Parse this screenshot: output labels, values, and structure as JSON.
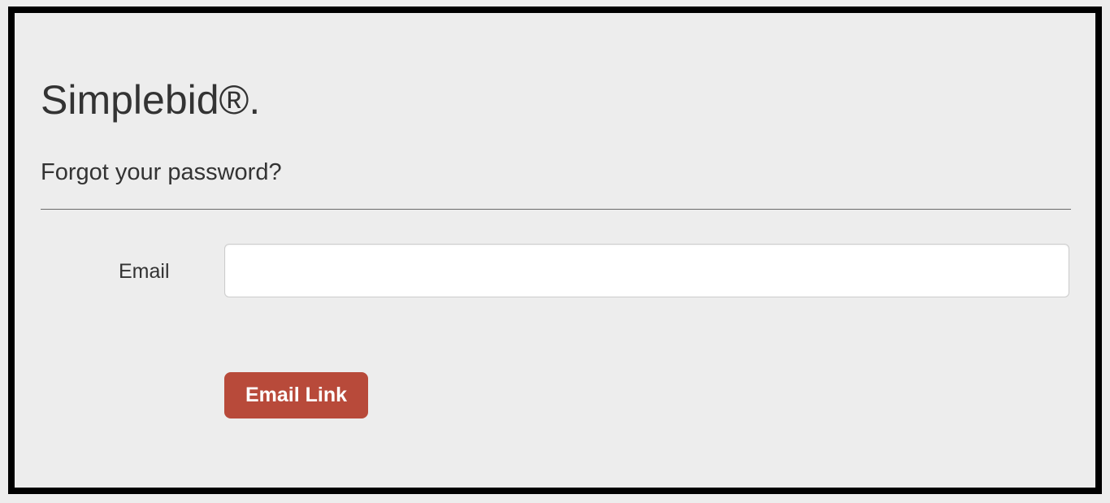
{
  "page": {
    "title": "Simplebid®.",
    "subtitle": "Forgot your password?"
  },
  "form": {
    "email_label": "Email",
    "email_value": "",
    "submit_label": "Email Link"
  }
}
